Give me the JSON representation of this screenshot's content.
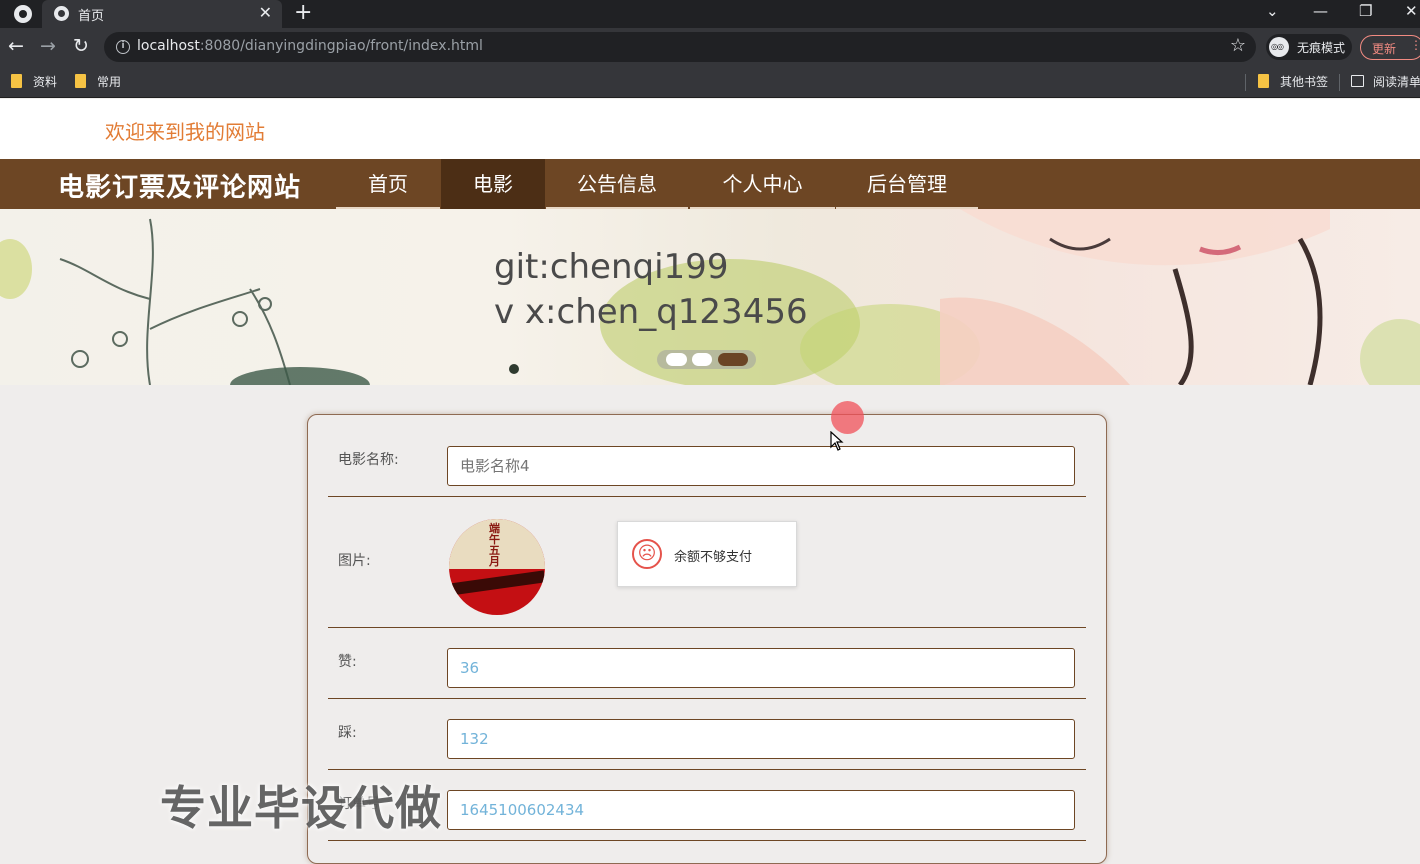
{
  "browser": {
    "tab_title": "首页",
    "tab_close": "✕",
    "new_tab": "+",
    "win_controls": [
      "⌄",
      "—",
      "❐",
      "✕"
    ],
    "url_host": "localhost",
    "url_path": ":8080/dianyingdingpiao/front/index.html",
    "incognito_label": "无痕模式",
    "update_label": "更新",
    "more": "⋮",
    "bookmarks": [
      "资料",
      "常用"
    ],
    "bookmarks_right": [
      "其他书签",
      "阅读清单"
    ]
  },
  "site": {
    "welcome": "欢迎来到我的网站",
    "title": "电影订票及评论网站",
    "nav": [
      "首页",
      "电影",
      "公告信息",
      "个人中心",
      "后台管理"
    ],
    "active_nav": "电影",
    "banner_lines": [
      "git:chenqi199",
      "v x:chen_q123456"
    ],
    "carousel_dots": 3,
    "carousel_active": 3
  },
  "form": {
    "name_label": "电影名称:",
    "name_placeholder": "电影名称4",
    "image_label": "图片:",
    "poster_text": "端午五月",
    "like_label": "赞:",
    "like_value": "36",
    "dislike_label": "踩:",
    "dislike_value": "132",
    "id_label": "订单号",
    "id_value": "1645100602434"
  },
  "toast": {
    "message": "余额不够支付",
    "icon": "sad-face-icon"
  },
  "watermark": "专业毕设代做",
  "colors": {
    "nav_bg": "#6d4624",
    "nav_active": "#4c2e15",
    "welcome": "#e27c35",
    "input_text": "#72b3d9",
    "error": "#e5534b"
  }
}
